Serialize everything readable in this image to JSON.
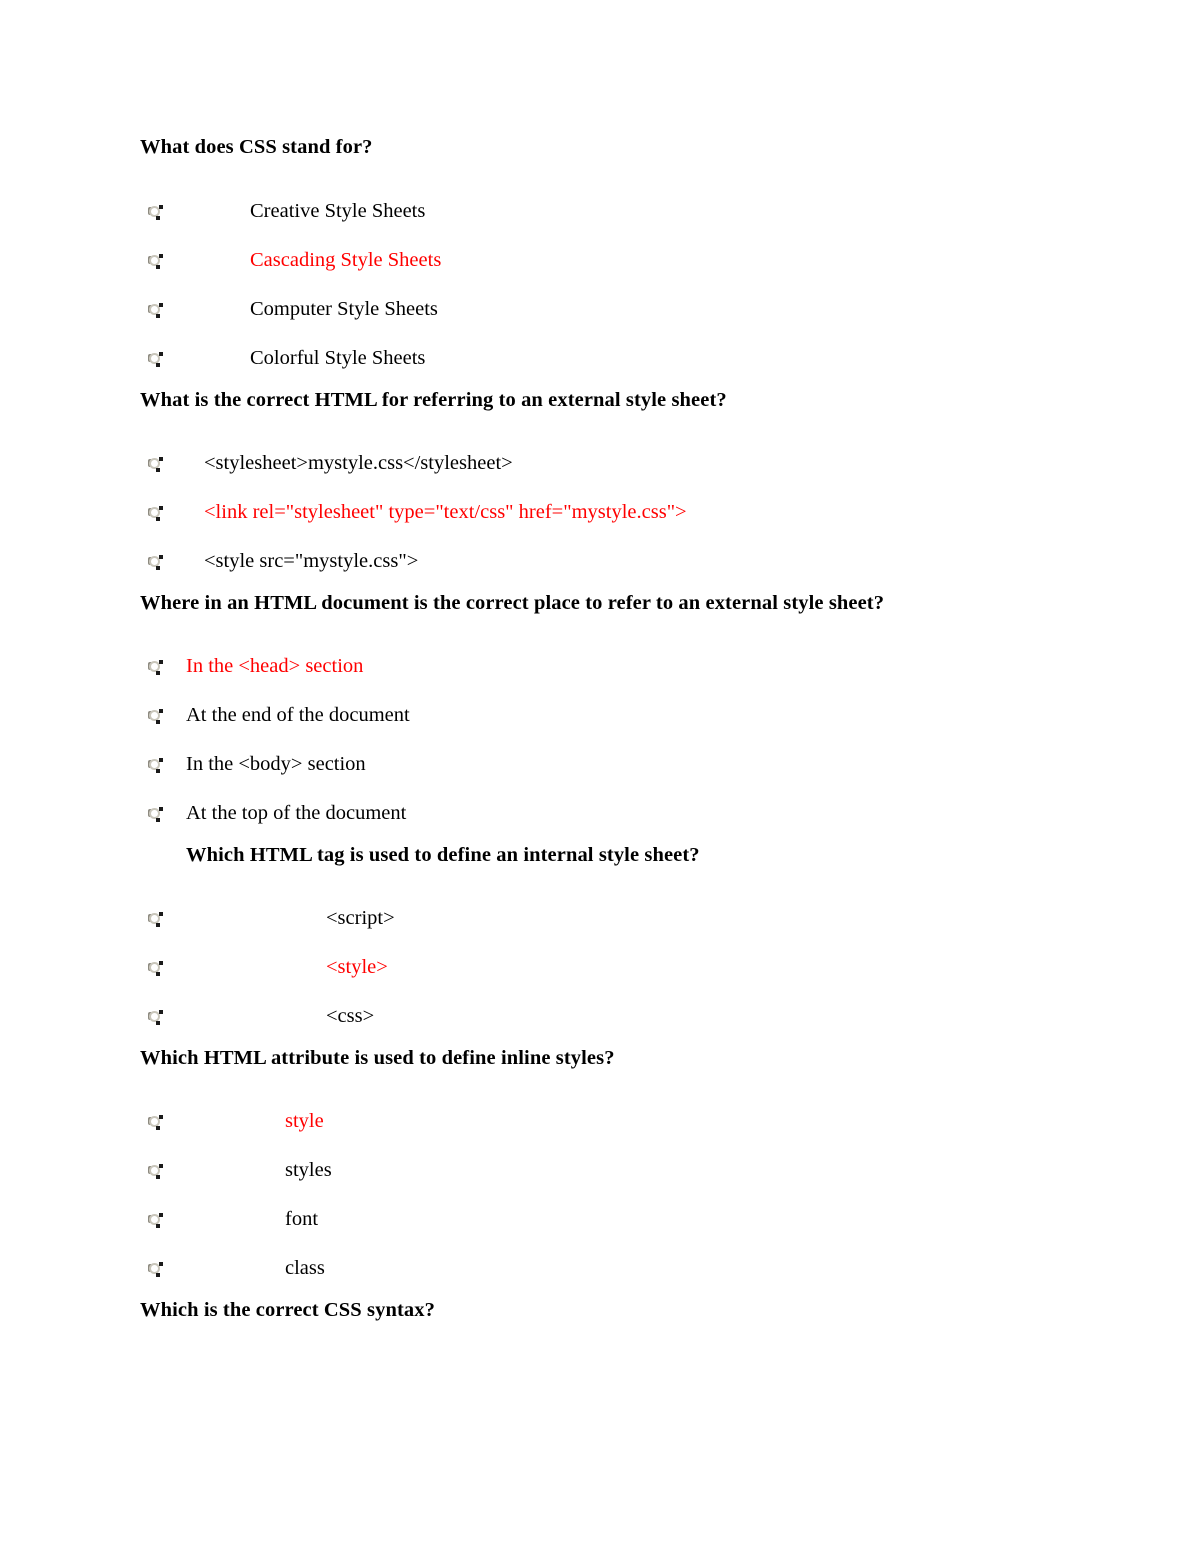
{
  "document": {
    "type": "quiz-worksheet",
    "page_background": "#ffffff",
    "text_color": "#000000",
    "correct_answer_color": "#ff0000",
    "radio_glyph_name": "radio-button-unselected-glyph"
  },
  "questions": [
    {
      "id": "q1",
      "heading": "What does CSS stand for?",
      "heading_indent": 0,
      "option_indent": 110,
      "options": [
        {
          "label": "Creative Style Sheets",
          "correct": false
        },
        {
          "label": "Cascading Style Sheets",
          "correct": true
        },
        {
          "label": "Computer Style Sheets",
          "correct": false
        },
        {
          "label": "Colorful Style Sheets",
          "correct": false
        }
      ]
    },
    {
      "id": "q2",
      "heading": "What is the correct HTML for referring to an external style sheet?",
      "heading_indent": 0,
      "option_indent": 64,
      "options": [
        {
          "label": "<stylesheet>mystyle.css</stylesheet>",
          "correct": false
        },
        {
          "label": "<link rel=\"stylesheet\" type=\"text/css\" href=\"mystyle.css\">",
          "correct": true
        },
        {
          "label": "<style src=\"mystyle.css\">",
          "correct": false
        }
      ]
    },
    {
      "id": "q3",
      "heading": "Where in an HTML document is the correct place to refer to an external style sheet?",
      "heading_indent": 0,
      "option_indent": 46,
      "options": [
        {
          "label": "In the <head> section",
          "correct": true
        },
        {
          "label": "At the end of the document",
          "correct": false
        },
        {
          "label": "In the <body> section",
          "correct": false
        },
        {
          "label": "At the top of the document",
          "correct": false
        }
      ]
    },
    {
      "id": "q4",
      "heading": "Which HTML tag is used to define an internal style sheet?",
      "heading_indent": 46,
      "option_indent": 186,
      "options": [
        {
          "label": "<script>",
          "correct": false
        },
        {
          "label": "<style>",
          "correct": true
        },
        {
          "label": "<css>",
          "correct": false
        }
      ]
    },
    {
      "id": "q5",
      "heading": "Which HTML attribute is used to define inline styles?",
      "heading_indent": 0,
      "option_indent": 145,
      "options": [
        {
          "label": "style",
          "correct": true
        },
        {
          "label": "styles",
          "correct": false
        },
        {
          "label": "font",
          "correct": false
        },
        {
          "label": "class",
          "correct": false
        }
      ]
    }
  ],
  "trailing_heading": {
    "heading": "Which is the correct CSS syntax?",
    "heading_indent": 0
  }
}
